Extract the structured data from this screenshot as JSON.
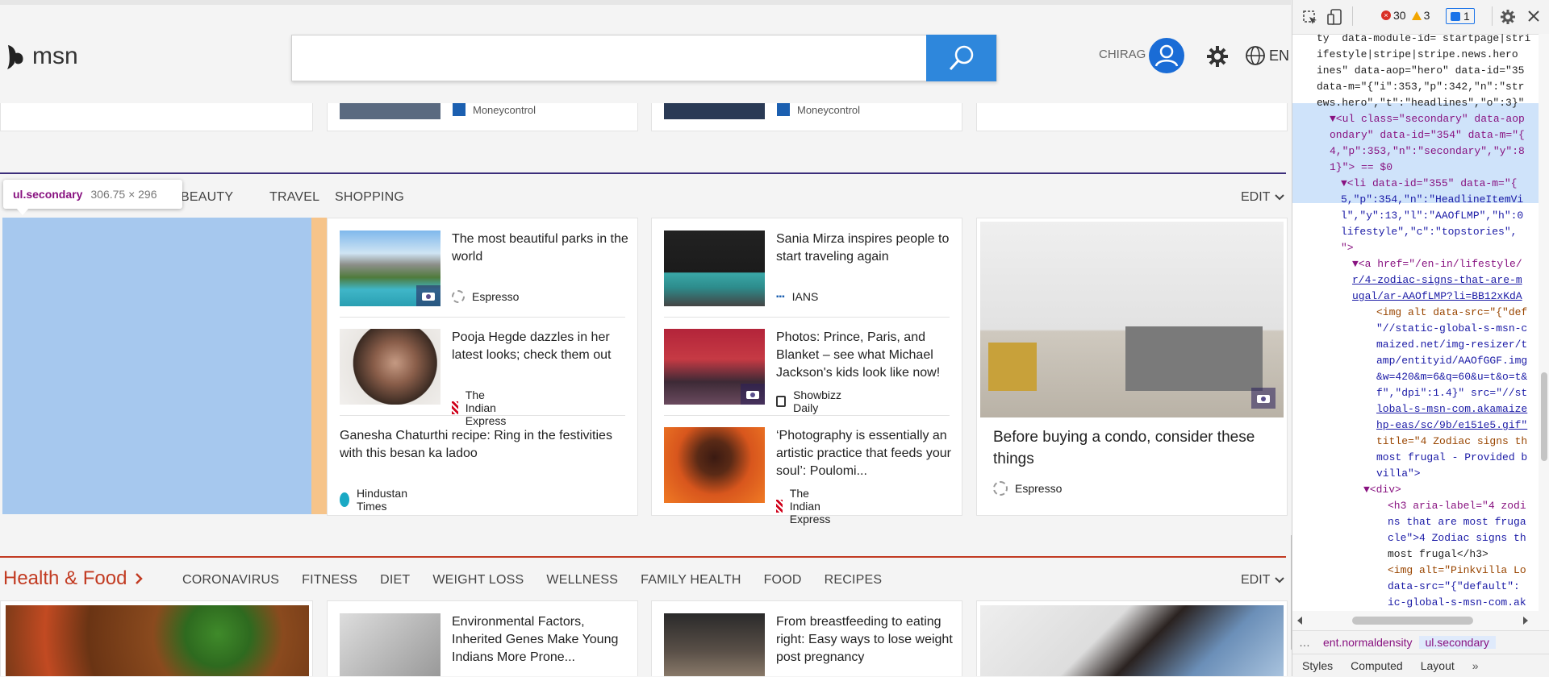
{
  "header": {
    "logo_text": "msn",
    "search_placeholder": "",
    "username": "CHIRAG",
    "language": "EN"
  },
  "lifestyle": {
    "nav_items": [
      "BEAUTY",
      "TRAVEL",
      "SHOPPING"
    ],
    "edit_label": "EDIT",
    "inspector_tooltip": {
      "tag": "ul.secondary",
      "size": "306.75 × 296"
    },
    "col1": [
      {
        "title": "The most beautiful parks in the world",
        "source": "Espresso"
      },
      {
        "title": "Pooja Hegde dazzles in her latest looks; check them out",
        "source": "The Indian Express"
      },
      {
        "title": "Ganesha Chaturthi recipe: Ring in the festivities with this besan ka ladoo",
        "source": "Hindustan Times"
      }
    ],
    "col2": [
      {
        "title": "Sania Mirza inspires people to start traveling again",
        "source": "IANS"
      },
      {
        "title": "Photos: Prince, Paris, and Blanket – see what Michael Jackson's kids look like now!",
        "source": "Showbizz Daily"
      },
      {
        "title": "‘Photography is essentially an artistic practice that feeds your soul’: Poulomi...",
        "source": "The Indian Express"
      }
    ],
    "feature": {
      "title": "Before buying a condo, consider these things",
      "source": "Espresso"
    },
    "top_row_sources": [
      "Moneycontrol",
      "Moneycontrol"
    ]
  },
  "health": {
    "heading": "Health & Food",
    "nav_items": [
      "CORONAVIRUS",
      "FITNESS",
      "DIET",
      "WEIGHT LOSS",
      "WELLNESS",
      "FAMILY HEALTH",
      "FOOD",
      "RECIPES"
    ],
    "edit_label": "EDIT",
    "col1_title": "Environmental Factors, Inherited Genes Make Young Indians More Prone...",
    "col2_title": "From breastfeeding to eating right: Easy ways to lose weight post pregnancy"
  },
  "devtools": {
    "error_count": "30",
    "warning_count": "3",
    "message_count": "1",
    "code_lines": [
      "ty  data-module-id= startpage|stri",
      "ifestyle|stripe|stripe.news.hero",
      "ines\" data-aop=\"hero\" data-id=\"35",
      "data-m=\"{\"i\":353,\"p\":342,\"n\":\"str",
      "ews.hero\",\"t\":\"headlines\",\"o\":3}\"",
      "▼<ul class=\"secondary\" data-aop",
      "ondary\" data-id=\"354\" data-m=\"{",
      "4,\"p\":353,\"n\":\"secondary\",\"y\":8",
      "1}\"> == $0",
      "▼<li data-id=\"355\" data-m=\"{",
      "5,\"p\":354,\"n\":\"HeadlineItemVi",
      "l\",\"y\":13,\"l\":\"AAOfLMP\",\"h\":0",
      "lifestyle\",\"c\":\"topstories\",",
      "\">",
      "▼<a href=\"/en-in/lifestyle/",
      "r/4-zodiac-signs-that-are-m",
      "ugal/ar-AAOfLMP?li=BB12xKdA",
      "<img alt data-src=\"{\"def",
      "\"//static-global-s-msn-c",
      "maized.net/img-resizer/t",
      "amp/entityid/AAOfGGF.img",
      "&w=420&m=6&q=60&u=t&o=t&",
      "f\",\"dpi\":1.4}\" src=\"//st",
      "lobal-s-msn-com.akamaize",
      "hp-eas/sc/9b/e151e5.gif\"",
      "title=\"4 Zodiac signs th",
      "most frugal - Provided b",
      "villa\">",
      "▼<div>",
      "<h3 aria-label=\"4 zodi",
      "ns that are most fruga",
      "cle\">4 Zodiac signs th",
      "most frugal</h3>",
      "<img alt=\"Pinkvilla Lo",
      "data-src=\"{\"default\":",
      "ic-global-s-msn-com.ak"
    ],
    "breadcrumbs": [
      "ent.normaldensity",
      "ul.secondary"
    ],
    "bottom_tabs": [
      "Styles",
      "Computed",
      "Layout"
    ]
  },
  "colors": {
    "accent_blue": "#2e87dc",
    "lifestyle_rule": "#3b2d7a",
    "health_red": "#c23b22",
    "inspector_highlight": "#a6c8ee",
    "padding_highlight": "#f6c48a"
  }
}
